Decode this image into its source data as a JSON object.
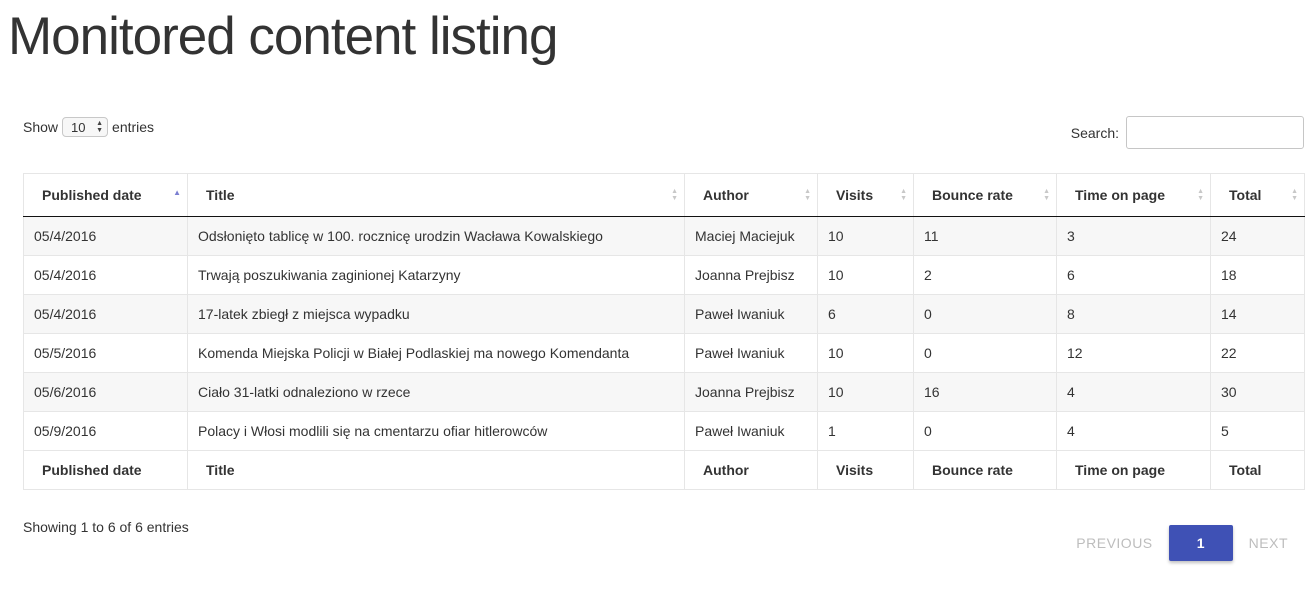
{
  "page_title": "Monitored content listing",
  "length": {
    "prefix": "Show",
    "value": "10",
    "suffix": "entries"
  },
  "search": {
    "label": "Search:",
    "value": "",
    "placeholder": ""
  },
  "columns": [
    "Published date",
    "Title",
    "Author",
    "Visits",
    "Bounce rate",
    "Time on page",
    "Total"
  ],
  "rows": [
    [
      "05/4/2016",
      "Odsłonięto tablicę w 100. rocznicę urodzin Wacława Kowalskiego",
      "Maciej Maciejuk",
      "10",
      "11",
      "3",
      "24"
    ],
    [
      "05/4/2016",
      "Trwają poszukiwania zaginionej Katarzyny",
      "Joanna Prejbisz",
      "10",
      "2",
      "6",
      "18"
    ],
    [
      "05/4/2016",
      "17-latek zbiegł z miejsca wypadku",
      "Paweł Iwaniuk",
      "6",
      "0",
      "8",
      "14"
    ],
    [
      "05/5/2016",
      "Komenda Miejska Policji w Białej Podlaskiej ma nowego Komendanta",
      "Paweł Iwaniuk",
      "10",
      "0",
      "12",
      "22"
    ],
    [
      "05/6/2016",
      "Ciało 31-latki odnaleziono w rzece",
      "Joanna Prejbisz",
      "10",
      "16",
      "4",
      "30"
    ],
    [
      "05/9/2016",
      "Polacy i Włosi modlili się na cmentarzu ofiar hitlerowców",
      "Paweł Iwaniuk",
      "1",
      "0",
      "4",
      "5"
    ]
  ],
  "info": "Showing 1 to 6 of 6 entries",
  "pagination": {
    "previous": "PREVIOUS",
    "current": "1",
    "next": "NEXT"
  },
  "colors": {
    "accent": "#3f51b5",
    "sort_active": "#7b7fd1",
    "stripe": "#f7f7f7"
  },
  "sort": {
    "column": "Published date",
    "direction": "ascending"
  }
}
